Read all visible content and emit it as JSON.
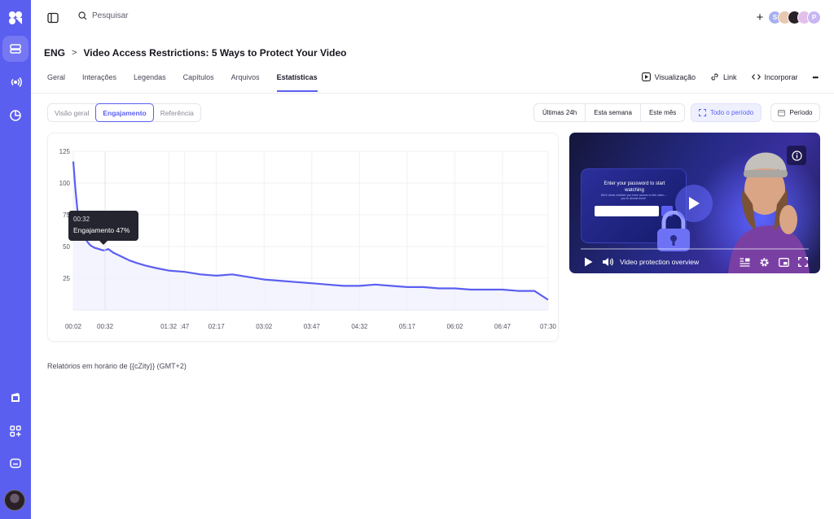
{
  "topbar": {
    "search_placeholder": "Pesquisar",
    "add_label": "+",
    "avatars": [
      {
        "initial": "S",
        "color": "#a8b0f0"
      },
      {
        "initial": "",
        "color": "#e8c8b0"
      },
      {
        "initial": "",
        "color": "#2a2028"
      },
      {
        "initial": "",
        "color": "#e3c0ea"
      },
      {
        "initial": "P",
        "color": "#c8b6f4"
      }
    ]
  },
  "breadcrumb": {
    "parent": "ENG",
    "separator": ">",
    "title": "Video Access Restrictions: 5 Ways to Protect Your Video"
  },
  "tabs": [
    {
      "label": "Geral",
      "active": false
    },
    {
      "label": "Interações",
      "active": false
    },
    {
      "label": "Legendas",
      "active": false
    },
    {
      "label": "Capítulos",
      "active": false
    },
    {
      "label": "Arquivos",
      "active": false
    },
    {
      "label": "Estatísticas",
      "active": true
    }
  ],
  "tab_actions": {
    "preview": "Visualização",
    "link": "Link",
    "embed": "Incorporar",
    "more": "•••"
  },
  "stats_views": [
    {
      "label": "Visão geral",
      "active": false
    },
    {
      "label": "Engajamento",
      "active": true
    },
    {
      "label": "Referência",
      "active": false
    }
  ],
  "ranges": {
    "last24h": "Últimas 24h",
    "week": "Esta semana",
    "month": "Este mês",
    "all": "Todo o período",
    "period": "Período"
  },
  "chart_data": {
    "type": "line",
    "title": "",
    "xlabel": "",
    "ylabel": "",
    "y_ticks": [
      "125",
      "100",
      "75",
      "50",
      "25"
    ],
    "ylim": [
      0,
      125
    ],
    "x_ticks": [
      "00:02",
      "00:32",
      "01:47",
      "01:32",
      "02:17",
      "03:02",
      "03:47",
      "04:32",
      "05:17",
      "06:02",
      "06:47",
      "07:30"
    ],
    "x_tick_displayed": [
      "00:02",
      "00:32",
      ":47",
      "01:32",
      "02:17",
      "03:02",
      "03:47",
      "04:32",
      "05:17",
      "06:02",
      "06:47",
      "07:30"
    ],
    "xlim_seconds": [
      2,
      450
    ],
    "grid": true,
    "color": "#5b5ff0",
    "series": [
      {
        "x": [
          2,
          4,
          6,
          9,
          12,
          15,
          18,
          22,
          26,
          30,
          32,
          35,
          40,
          45,
          50,
          55,
          62,
          70,
          80,
          92,
          107,
          122,
          137,
          152,
          167,
          182,
          197,
          212,
          227,
          242,
          257,
          272,
          287,
          302,
          317,
          332,
          347,
          362,
          377,
          392,
          407,
          422,
          437,
          450
        ],
        "y": [
          117,
          95,
          78,
          66,
          59,
          54,
          51,
          49,
          48,
          47,
          47,
          48,
          45,
          43,
          41,
          39,
          37,
          35,
          33,
          31,
          30,
          28,
          27,
          28,
          26,
          24,
          23,
          22,
          21,
          20,
          19,
          19,
          20,
          19,
          18,
          18,
          17,
          17,
          16,
          16,
          16,
          15,
          15,
          8
        ]
      }
    ],
    "tooltip": {
      "time": "00:32",
      "label": "Engajamento 47%"
    }
  },
  "timezone_note": "Relatórios em horário de {{cZity}} (GMT+2)",
  "video": {
    "pw_title": "Enter your password to start watching",
    "pw_sub": "We'll check whether you have access to this video – you're almost there!",
    "title": "Video protection overview"
  }
}
